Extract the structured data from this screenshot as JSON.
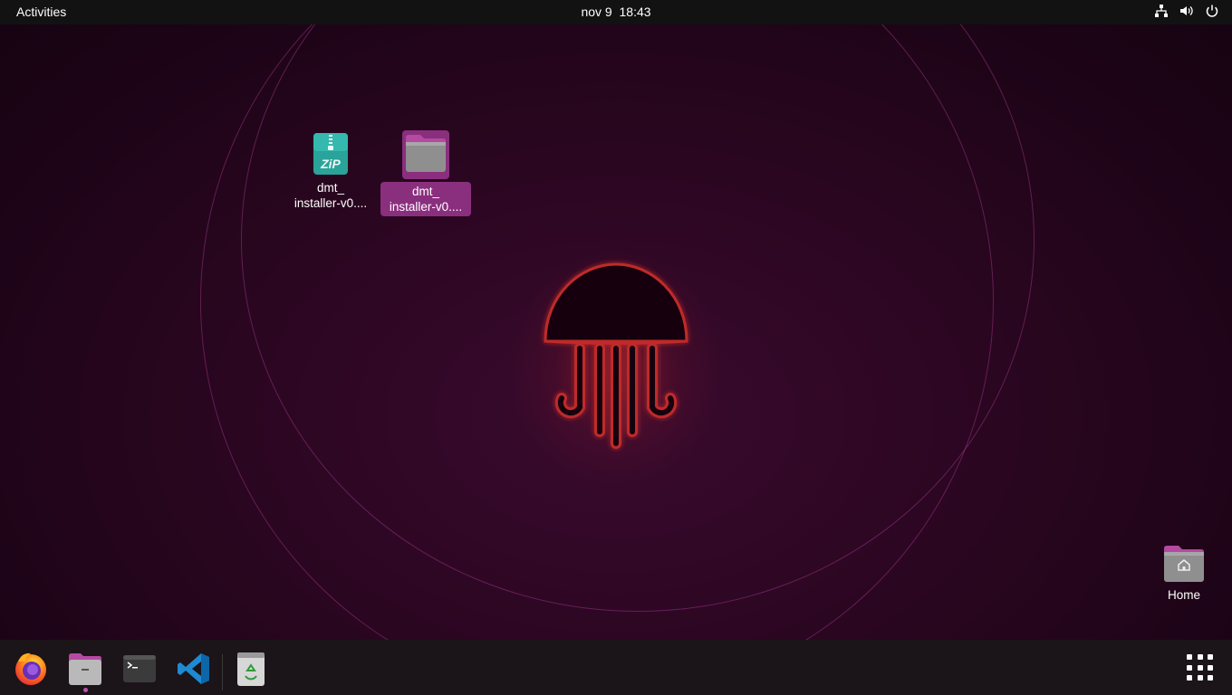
{
  "topbar": {
    "activities_label": "Activities",
    "clock": "nov 9  18:43",
    "tray_icons": [
      "network-icon",
      "volume-icon",
      "power-icon"
    ]
  },
  "desktop": {
    "items": [
      {
        "label_line1": "dmt_",
        "label_line2": "installer-v0....",
        "icon": "zip-archive-icon",
        "icon_text": "ZiP",
        "selected": false
      },
      {
        "label_line1": "dmt_",
        "label_line2": "installer-v0....",
        "icon": "folder-icon",
        "selected": true
      },
      {
        "label": "Home",
        "icon": "home-folder-icon"
      }
    ]
  },
  "dock": {
    "apps": [
      "firefox-icon",
      "files-icon",
      "terminal-icon",
      "vscode-icon",
      "trash-icon"
    ],
    "show_apps": "show-applications-icon"
  },
  "colors": {
    "accent": "#8a2f7e",
    "topbar": "#121212",
    "dock": "#1b1418"
  }
}
